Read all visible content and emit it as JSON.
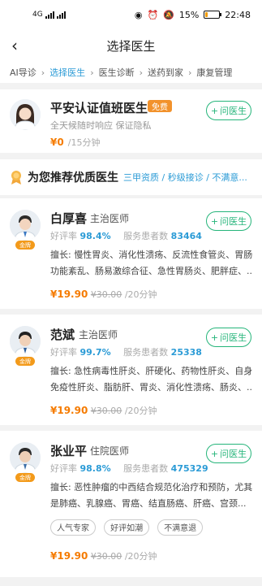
{
  "status_bar": {
    "network": "4G",
    "battery": "15%",
    "time": "22:48"
  },
  "header": {
    "title": "选择医生"
  },
  "steps": [
    "AI导诊",
    "选择医生",
    "医生诊断",
    "送药到家",
    "康复管理"
  ],
  "on_duty": {
    "title": "平安认证值班医生",
    "free_tag": "免费",
    "subtitle": "全天候随时响应  保证隐私",
    "price": "¥0",
    "duration": "/15分钟",
    "ask_label": "问医生"
  },
  "recommend": {
    "title": "为您推荐优质医生",
    "tags": "三甲资质 / 秒级接诊 / 不满意..."
  },
  "doctors": [
    {
      "name": "白厚喜",
      "title": "主治医师",
      "badge": "金牌",
      "rating_label": "好评率",
      "rating": "98.4%",
      "served_label": "服务患者数",
      "served": "83464",
      "desc_line1": "擅长: 慢性胃炎、消化性溃疡、反流性食管炎、胃肠",
      "desc_line2": "功能紊乱、肠易激综合征、急性胃肠炎、肥胖症、...",
      "price": "¥19.90",
      "original_price": "¥30.00",
      "duration": "/20分钟",
      "ask_label": "问医生"
    },
    {
      "name": "范斌",
      "title": "主治医师",
      "badge": "金牌",
      "rating_label": "好评率",
      "rating": "99.7%",
      "served_label": "服务患者数",
      "served": "25338",
      "desc_line1": "擅长: 急性病毒性肝炎、肝硬化、药物性肝炎、自身",
      "desc_line2": "免疫性肝炎、脂肪肝、胃炎、消化性溃疡、肠炎、...",
      "price": "¥19.90",
      "original_price": "¥30.00",
      "duration": "/20分钟",
      "ask_label": "问医生"
    },
    {
      "name": "张业平",
      "title": "住院医师",
      "badge": "金牌",
      "rating_label": "好评率",
      "rating": "98.8%",
      "served_label": "服务患者数",
      "served": "475329",
      "desc_line1": "擅长: 恶性肿瘤的中西结合规范化治疗和预防，尤其",
      "desc_line2": "是肺癌、乳腺癌、胃癌、结直肠癌、肝癌、宫颈...",
      "chips": [
        "人气专家",
        "好评如潮",
        "不满意退"
      ],
      "price": "¥19.90",
      "original_price": "¥30.00",
      "duration": "/20分钟",
      "ask_label": "问医生"
    }
  ],
  "colors": {
    "accent_blue": "#2b9bd6",
    "price_orange": "#f57b00",
    "green": "#25b57a",
    "badge_orange": "#f39a1a"
  }
}
